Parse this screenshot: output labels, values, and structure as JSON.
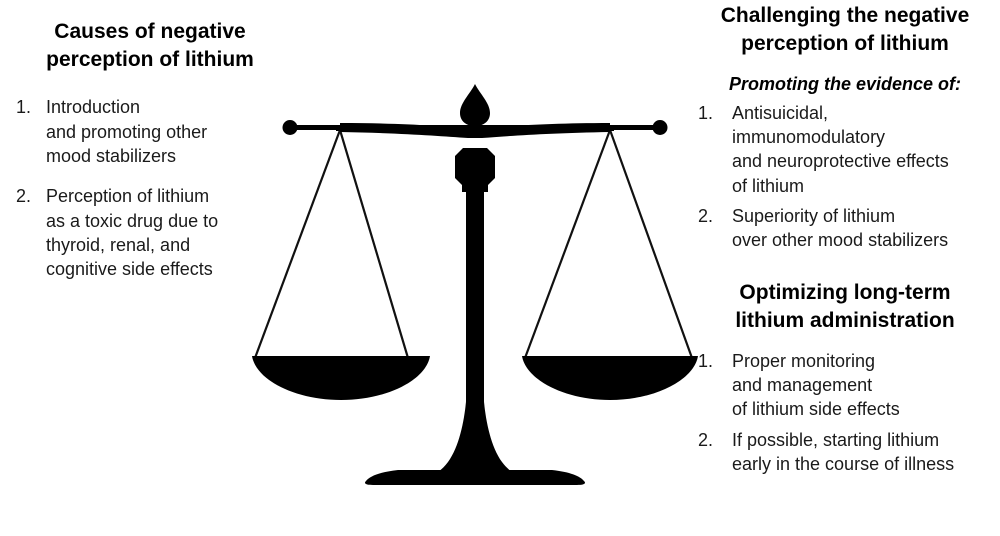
{
  "left": {
    "heading": "Causes of negative perception of lithium",
    "heading_lines": [
      "Causes of negative",
      "perception of lithium"
    ],
    "items": [
      {
        "num": "1.",
        "lines": [
          "Introduction",
          "and promoting other",
          "mood stabilizers"
        ]
      },
      {
        "num": "2.",
        "lines": [
          "Perception of lithium",
          "as a toxic drug due to",
          "thyroid, renal, and",
          "cognitive side effects"
        ]
      }
    ]
  },
  "right": {
    "heading": "Challenging the negative perception of lithium",
    "heading_lines": [
      "Challenging the negative",
      "perception of lithium"
    ],
    "subheading": "Promoting the evidence of:",
    "items": [
      {
        "num": "1.",
        "lines": [
          "Antisuicidal,",
          "immunomodulatory",
          "and neuroprotective effects",
          "of lithium"
        ]
      },
      {
        "num": "2.",
        "lines": [
          "Superiority of lithium",
          "over other mood stabilizers"
        ]
      }
    ],
    "heading2": "Optimizing long-term lithium administration",
    "heading2_lines": [
      "Optimizing long-term",
      "lithium administration"
    ],
    "items2": [
      {
        "num": "1.",
        "lines": [
          "Proper monitoring",
          "and management",
          "of lithium side effects"
        ]
      },
      {
        "num": "2.",
        "lines": [
          "If possible, starting lithium",
          "early in the course of illness"
        ]
      }
    ]
  },
  "illustration": {
    "name": "balance-scale",
    "description": "Black silhouette of a two-pan balance scale, pans level",
    "fill_color": "#000000",
    "background_color": "#ffffff"
  }
}
